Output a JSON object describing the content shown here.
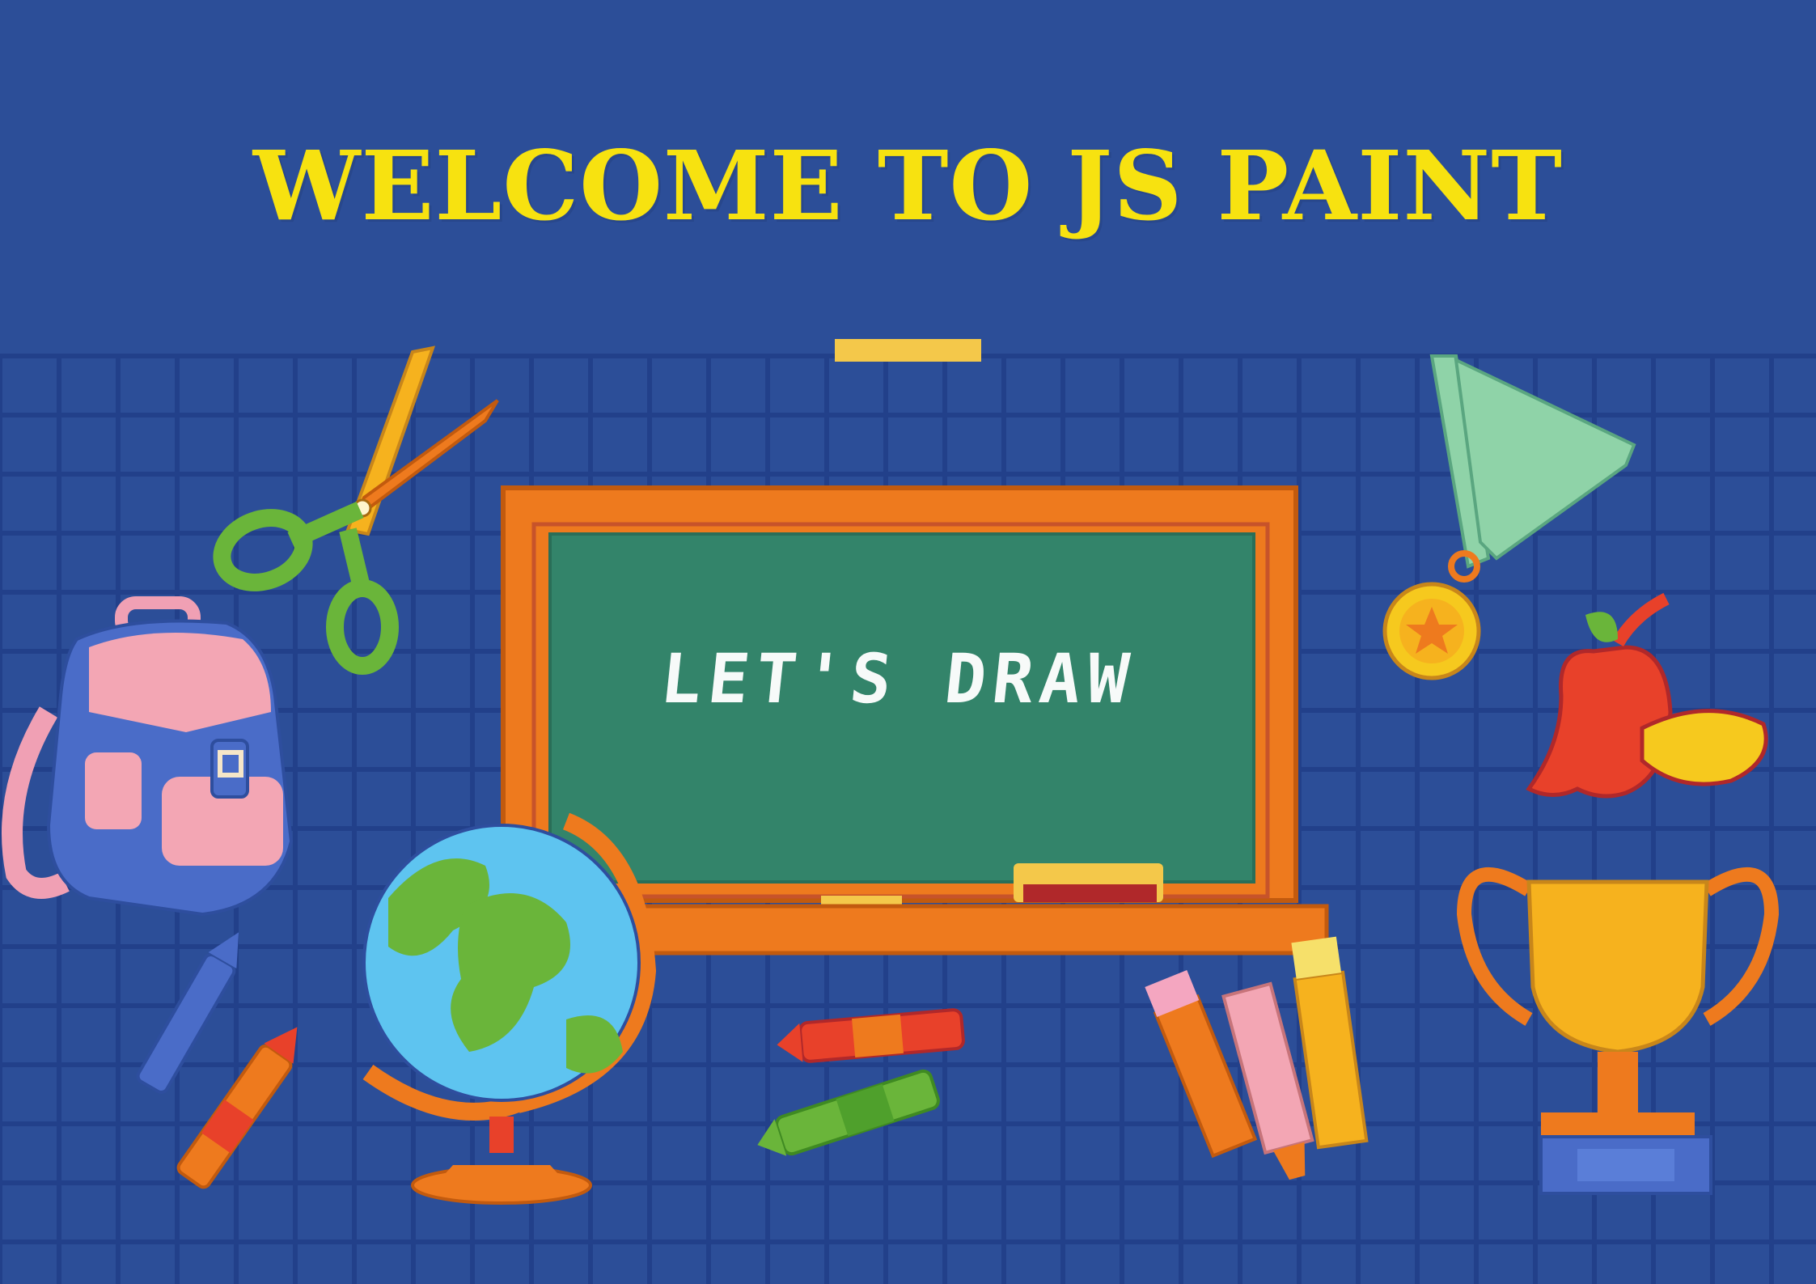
{
  "header": {
    "title": "WELCOME  TO JS PAINT"
  },
  "chalkboard": {
    "text": "LET'S DRAW"
  },
  "colors": {
    "background": "#2c4e98",
    "grid": "#25438a",
    "title": "#f7e210",
    "accent_bar": "#f4c84a",
    "board": "#33846a",
    "frame": "#ee7a1e"
  },
  "decorations": [
    "scissors-icon",
    "backpack-icon",
    "crayon-icon",
    "globe-icon",
    "chalkboard-icon",
    "medal-icon",
    "apple-icon",
    "trophy-icon",
    "marker-icon"
  ]
}
